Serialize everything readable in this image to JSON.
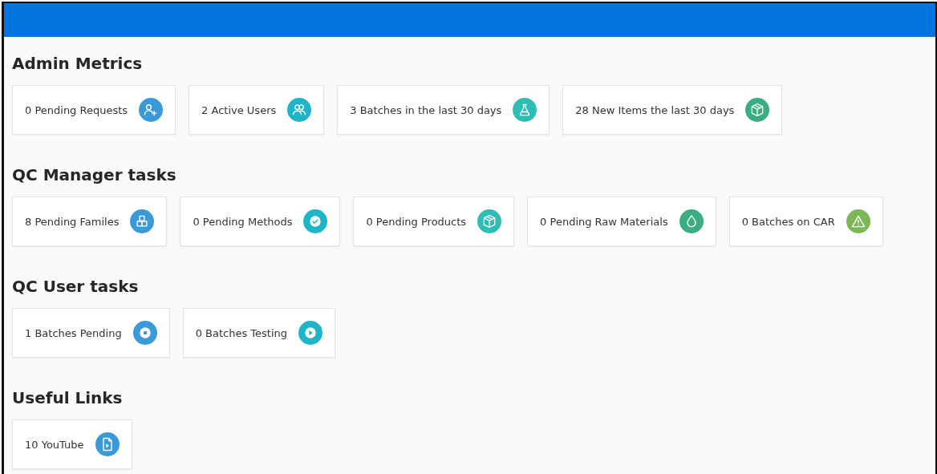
{
  "sections": [
    {
      "title": "Admin Metrics",
      "cards": [
        {
          "label": "0 Pending Requests",
          "kind": "user-add",
          "color": "#3a9ad9"
        },
        {
          "label": "2 Active Users",
          "kind": "users",
          "color": "#1fb5c9"
        },
        {
          "label": "3 Batches in the last 30 days",
          "kind": "flask",
          "color": "#2fbcb4"
        },
        {
          "label": "28 New Items the last 30 days",
          "kind": "package",
          "color": "#3aae82"
        }
      ]
    },
    {
      "title": "QC Manager tasks",
      "cards": [
        {
          "label": "8 Pending Familes",
          "kind": "blocks",
          "color": "#3a9ad9"
        },
        {
          "label": "0 Pending Methods",
          "kind": "check",
          "color": "#1fb5c9"
        },
        {
          "label": "0 Pending Products",
          "kind": "package",
          "color": "#2fbcb4"
        },
        {
          "label": "0 Pending Raw Materials",
          "kind": "drop",
          "color": "#3aae82"
        },
        {
          "label": "0 Batches on CAR",
          "kind": "warning",
          "color": "#7cb757"
        }
      ]
    },
    {
      "title": "QC User tasks",
      "cards": [
        {
          "label": "1 Batches Pending",
          "kind": "stop",
          "color": "#3a9ad9"
        },
        {
          "label": "0 Batches Testing",
          "kind": "play",
          "color": "#1fb5c9"
        }
      ]
    },
    {
      "title": "Useful Links",
      "cards": [
        {
          "label": "10 YouTube",
          "kind": "video-file",
          "color": "#3a9ad9"
        }
      ]
    }
  ]
}
